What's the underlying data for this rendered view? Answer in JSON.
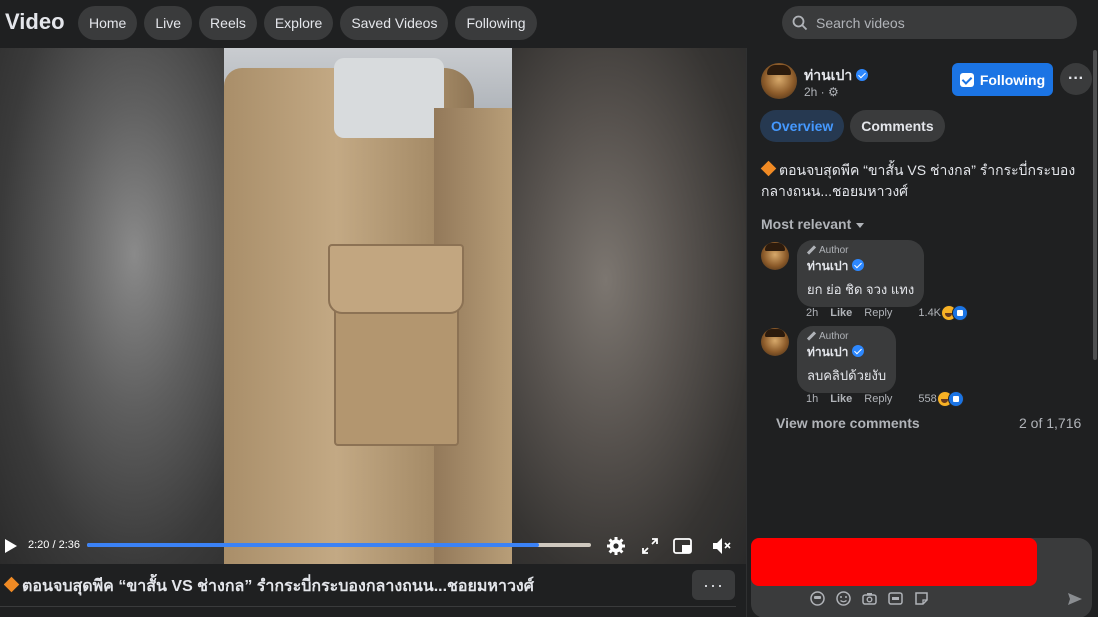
{
  "header": {
    "brand": "Video",
    "nav": [
      "Home",
      "Live",
      "Reels",
      "Explore",
      "Saved Videos",
      "Following"
    ],
    "search_placeholder": "Search videos"
  },
  "player": {
    "time": "2:20 / 2:36",
    "progress_fraction": 0.897,
    "icons": [
      "play-icon",
      "settings-icon",
      "fullscreen-icon",
      "miniplayer-icon",
      "mute-icon"
    ]
  },
  "video": {
    "title": "ตอนจบสุดพีค “ขาสั้น VS ช่างกล” รำกระบี่กระบองกลางถนน...ชอยมหาวงศ์",
    "more_label": "···"
  },
  "post": {
    "author": "ท่านเปา",
    "time": "2h ·",
    "follow_label": "Following",
    "more_label": "···",
    "tabs": [
      "Overview",
      "Comments"
    ],
    "description": "ตอนจบสุดพีค “ขาสั้น VS ช่างกล” รำกระบี่กระบองกลางถนน...ชอยมหาวงศ์",
    "sort_label": "Most relevant"
  },
  "comments": [
    {
      "tag": "Author",
      "name": "ท่านเปา",
      "text": "ยก ย่อ ชิด จวง แทง",
      "time": "2h",
      "like": "Like",
      "reply": "Reply",
      "reactions": "1.4K"
    },
    {
      "tag": "Author",
      "name": "ท่านเปา",
      "text": "ลบคลิปด้วยงับ",
      "time": "1h",
      "like": "Like",
      "reply": "Reply",
      "reactions": "558"
    }
  ],
  "footer": {
    "view_more": "View more comments",
    "count": "2 of 1,716"
  },
  "colors": {
    "accent": "#1b74e4",
    "tab_active_bg": "#263951",
    "tab_active_text": "#4599ff",
    "redaction": "#ff0000"
  }
}
